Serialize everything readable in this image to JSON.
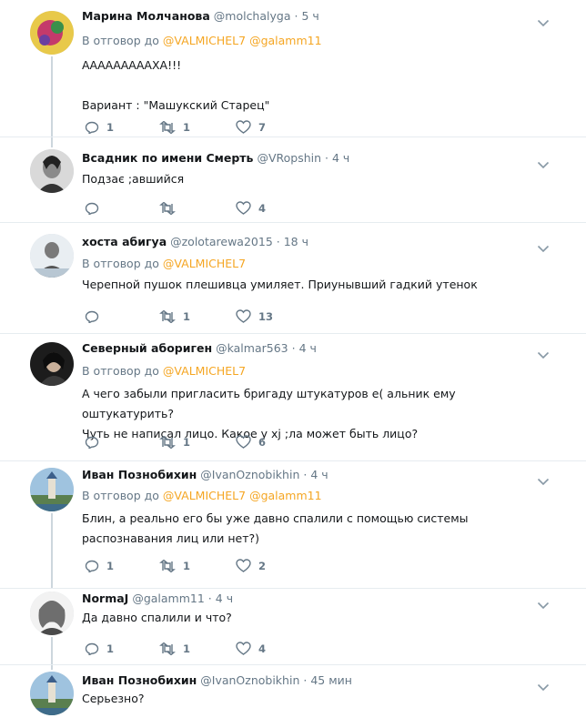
{
  "reply_prefix": "В отговор до",
  "tweets": [
    {
      "name": "Марина Молчанова",
      "handle": "@molchalyga",
      "time": "5 ч",
      "mentions": [
        "@VALMICHEL7",
        "@galamm11"
      ],
      "text": [
        "АААААААААХА!!!",
        "",
        "Вариант : \"Машукский Старец\""
      ],
      "replies": "1",
      "retweets": "1",
      "likes": "7"
    },
    {
      "name": "Всадник по имени Смерть",
      "handle": "@VRopshin",
      "time": "4 ч",
      "mentions": [],
      "text": [
        "Подзає ;авшийся"
      ],
      "replies": "",
      "retweets": "",
      "likes": "4"
    },
    {
      "name": "хоста абигуа",
      "handle": "@zolotarewa2015",
      "time": "18 ч",
      "mentions": [
        "@VALMICHEL7"
      ],
      "text": [
        "Черепной пушок  плешивца умиляет. Приунывший гадкий утенок"
      ],
      "replies": "",
      "retweets": "1",
      "likes": "13"
    },
    {
      "name": "Северный абориген",
      "handle": "@kalmar563",
      "time": "4 ч",
      "mentions": [
        "@VALMICHEL7"
      ],
      "text": [
        "А чего забыли пригласить бригаду штукатуров е( альник ему оштукатурить?",
        "Чуть не написал лицо. Какое у хј ;ла может быть лицо?"
      ],
      "replies": "",
      "retweets": "1",
      "likes": "6"
    },
    {
      "name": "Иван Познобихин",
      "handle": "@IvanOznobikhin",
      "time": "4 ч",
      "mentions": [
        "@VALMICHEL7",
        "@galamm11"
      ],
      "text": [
        "Блин, а реально его бы уже давно спалили с помощью системы",
        "распознавания лиц или нет?)"
      ],
      "replies": "1",
      "retweets": "1",
      "likes": "2"
    },
    {
      "name": "NormaJ",
      "handle": "@galamm11",
      "time": "4 ч",
      "mentions": [],
      "text": [
        "Да давно спалили и что?"
      ],
      "replies": "1",
      "retweets": "1",
      "likes": "4"
    },
    {
      "name": "Иван Познобихин",
      "handle": "@IvanOznobikhin",
      "time": "45 мин",
      "mentions": [],
      "text": [
        "Серьезно?"
      ],
      "replies": "",
      "retweets": "",
      "likes": ""
    }
  ],
  "colors": {
    "accent": "#f5a623",
    "muted": "#657786",
    "divider": "#e6ecf0"
  },
  "icons": [
    "reply-icon",
    "retweet-icon",
    "like-icon",
    "chevron-down-icon"
  ]
}
